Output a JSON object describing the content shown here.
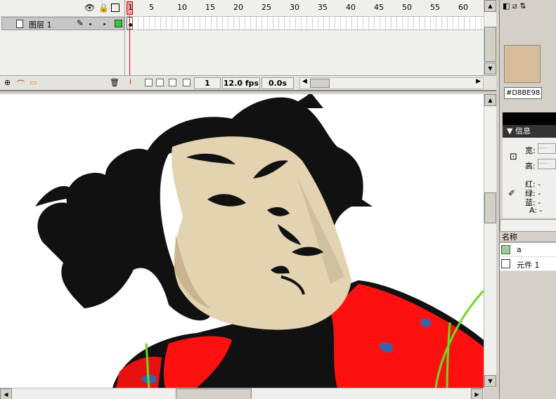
{
  "timeline": {
    "layer_name": "图层 1",
    "frame_numbers": [
      "5",
      "10",
      "15",
      "20",
      "25",
      "30",
      "35",
      "40",
      "45",
      "50",
      "55",
      "60"
    ],
    "current_frame": "1",
    "status": {
      "frame": "1",
      "fps": "12.0 fps",
      "time": "0.0s"
    }
  },
  "color": {
    "hex": "#D8BE98",
    "swatch": "#d8be98"
  },
  "info_panel": {
    "title": "信息",
    "width_label": "宽:",
    "height_label": "高:",
    "red_label": "红: -",
    "green_label": "绿: -",
    "blue_label": "蓝: -",
    "alpha_label": "A: -"
  },
  "library": {
    "column_name": "名称",
    "items": [
      {
        "name": "a",
        "icon": "bitmap-icon"
      },
      {
        "name": "元件 1",
        "icon": "graphic-symbol-icon"
      }
    ]
  },
  "icons": {
    "eye": "eye-icon",
    "lock": "lock-icon",
    "outline": "outline-icon",
    "pencil": "pencil-icon",
    "trash": "trash-icon"
  }
}
